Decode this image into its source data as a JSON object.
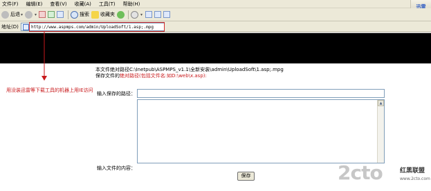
{
  "menubar": {
    "items": [
      "文件(F)",
      "编辑(E)",
      "查看(V)",
      "收藏(A)",
      "工具(T)",
      "帮助(H)"
    ],
    "brand_label": "迅雷"
  },
  "toolbar": {
    "back_label": "后退",
    "search_label": "搜索",
    "favorites_label": "收藏夹"
  },
  "addressbar": {
    "label": "地址(D)",
    "url": "http://www.aspmps.com/admin/UploadSoft/1.asp;.mpg"
  },
  "content": {
    "path_line": "本文件绝对路径C:\\Inetpub\\ASPMPS_v1.1\\全新安装\\admin\\UploadSoft\\1.asp;.mpg",
    "hint_prefix": "保存文件的",
    "hint_red": "绝对路径(包括文件名:如D:\\web\\x.asp):",
    "annotation": "用没装迅雷等下载工具的机器上用IE访问",
    "save_path_label": "输入保存的路径：",
    "save_path_value": "",
    "file_content_label": "输入文件的内容：",
    "save_button": "保存"
  },
  "watermark": {
    "logo": "2cto",
    "text": "红黑联盟",
    "url": "www.2cto.com"
  },
  "colors": {
    "annotation_red": "#c8191b",
    "chrome_bg": "#ece9d8"
  }
}
